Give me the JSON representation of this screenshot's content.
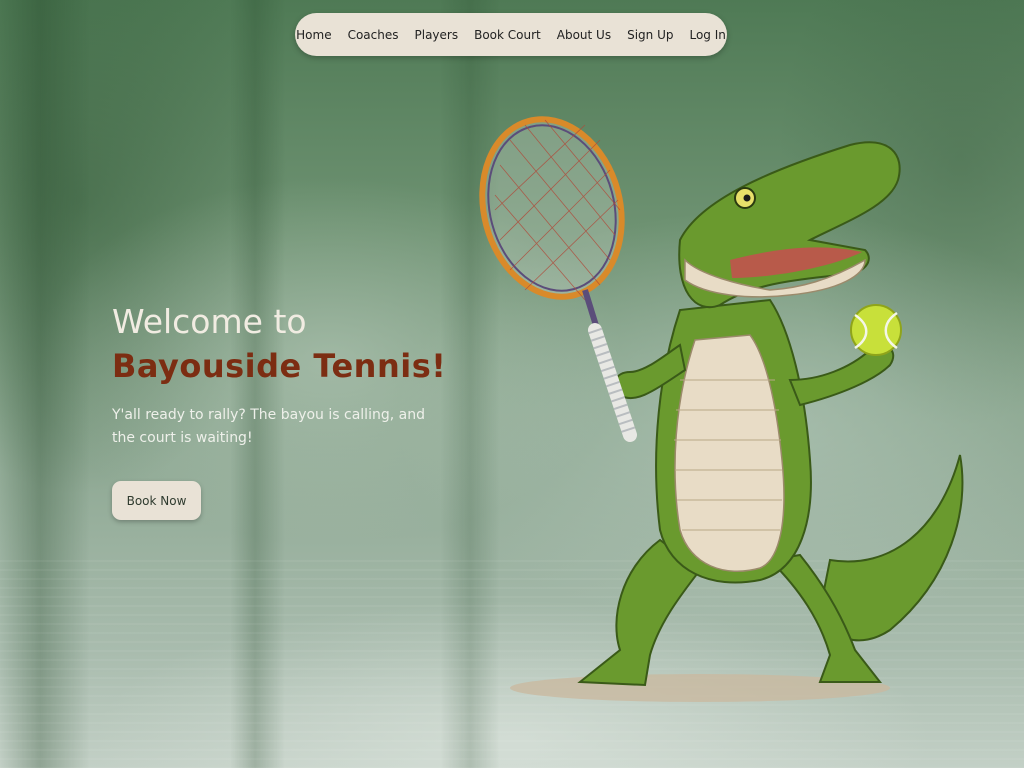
{
  "nav": {
    "items": [
      {
        "label": "Home"
      },
      {
        "label": "Coaches"
      },
      {
        "label": "Players"
      },
      {
        "label": "Book Court"
      },
      {
        "label": "About Us"
      },
      {
        "label": "Sign Up"
      },
      {
        "label": "Log In"
      }
    ]
  },
  "hero": {
    "line1": "Welcome to",
    "line2": "Bayouside Tennis!",
    "subtitle": "Y'all ready to rally? The bayou is calling, and the court is waiting!",
    "cta_label": "Book Now"
  },
  "colors": {
    "accent": "#7c2d12",
    "nav_bg": "#e9e2d6",
    "heading_light": "#f1ece2",
    "bg_green": "#6e9272"
  },
  "illustration": {
    "icon": "alligator-tennis-mascot-icon"
  }
}
